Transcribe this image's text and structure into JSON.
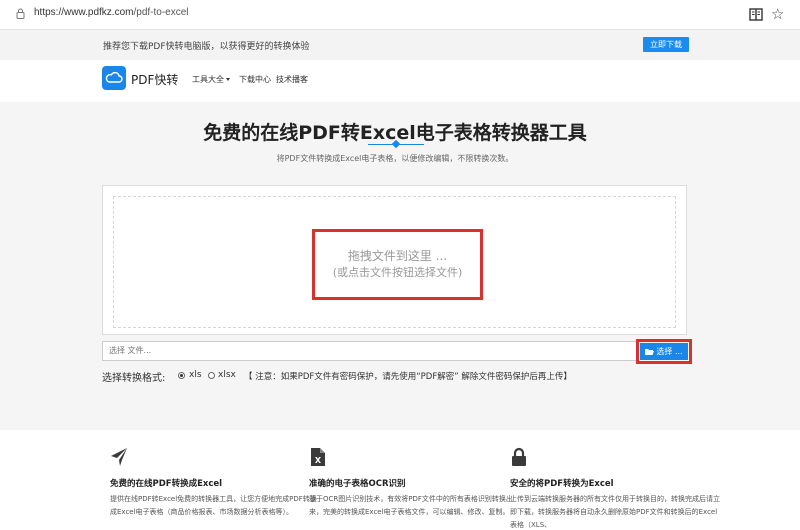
{
  "browser": {
    "url_main": "https://www.pdfkz.com",
    "url_path": "/pdf-to-excel",
    "icons": {
      "lock": "lock-icon",
      "reader": "reader-icon",
      "favorite": "star-icon"
    }
  },
  "promo": {
    "text": "推荐您下载PDF快转电脑版，以获得更好的转换体验",
    "button": "立即下载"
  },
  "nav": {
    "logo_text": "PDF快转",
    "links": [
      "工具大全",
      "下载中心",
      "技术播客"
    ]
  },
  "hero": {
    "title": "免费的在线PDF转Excel电子表格转换器工具",
    "subtitle": "将PDF文件转换成Excel电子表格，以便修改编辑，不限转换次数。"
  },
  "upload": {
    "drop_line1": "拖拽文件到这里 ...",
    "drop_line2": "(或点击文件按钮选择文件)",
    "file_placeholder": "选择 文件...",
    "choose_button": "选择 ..."
  },
  "format": {
    "label": "选择转换格式:",
    "options": [
      {
        "label": "xls",
        "selected": true
      },
      {
        "label": "xlsx",
        "selected": false
      }
    ],
    "note": "【 注意：如果PDF文件有密码保护，请先使用“PDF解密” 解除文件密码保护后再上传】"
  },
  "features": [
    {
      "icon": "paper-plane-icon",
      "title": "免费的在线PDF转换成Excel",
      "desc": "提供在线PDF转Excel免费的转换器工具，让您方便地完成PDF转换成Excel电子表格（商品价格报表、市场数据分析表格等）。"
    },
    {
      "icon": "excel-file-icon",
      "title": "准确的电子表格OCR识别",
      "desc": "基于OCR图片识别技术，有效将PDF文件中的所有表格识别转换出来，完美的转换成Excel电子表格文件，可以编辑、修改、复制。"
    },
    {
      "icon": "lock-icon",
      "title": "安全的将PDF转换为Excel",
      "desc": "上传到云端转换服务器的所有文件仅用于转换目的，转换完成后请立即下载，转换服务器将自动永久删除原始PDF文件和转换后的Excel表格（XLS、"
    }
  ],
  "colors": {
    "accent": "#1a86ea",
    "highlight": "#d9312b"
  }
}
